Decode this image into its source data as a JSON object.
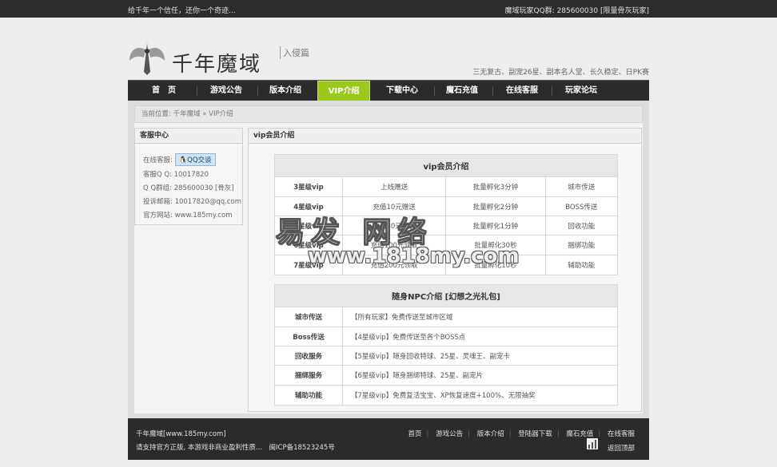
{
  "topbar": {
    "left": "给千年一个信任，还你一个奇迹...",
    "right": "魔域玩家QQ群: 285600030 [限量骨灰玩家]"
  },
  "logo": {
    "name": "千年魔域",
    "sub": "入侵篇"
  },
  "tagline": "三无复古、副宠26星、副本名人堂、长久稳定、日PK赛",
  "nav": [
    "首　页",
    "游戏公告",
    "版本介绍",
    "VIP介绍",
    "下载中心",
    "魔石充值",
    "在线客服",
    "玩家论坛"
  ],
  "nav_active": "VIP介绍",
  "colors": {
    "accent": "#9ac81d",
    "dark": "#2b2b2b"
  },
  "breadcrumb": "当前位置: 千年魔域 » VIP介绍",
  "sidebar": {
    "title": "客服中心",
    "online_label": "在线客服:",
    "qq_button": "QQ交谈",
    "lines": [
      "客服Q Q: 10017820",
      "Q Q群组: 285600030 [骨灰]",
      "投诉邮箱: 10017820@qq.com",
      "官方网站: www.185my.com"
    ]
  },
  "main": {
    "title": "vip会员介绍"
  },
  "vip_table": {
    "title": "vip会员介绍",
    "rows": [
      [
        "3星级vip",
        "上线赠送",
        "批量孵化3分钟",
        "城市传送"
      ],
      [
        "4星级vip",
        "充值10元赠送",
        "批量孵化2分钟",
        "BOSS传送"
      ],
      [
        "5星级vip",
        "充值30元领取",
        "批量孵化1分钟",
        "回收功能"
      ],
      [
        "6星级vip",
        "充值100元领取",
        "批量孵化30秒",
        "捆绑功能"
      ],
      [
        "7星级vip",
        "充值200元领取",
        "批量孵化10秒",
        "辅助功能"
      ]
    ]
  },
  "npc_table": {
    "title": "随身NPC介绍 [幻想之光礼包]",
    "rows": [
      [
        "城市传送",
        "【所有玩家】免费传送至城市区域"
      ],
      [
        "Boss传送",
        "【4星级vip】免费传送至各个BOSS点"
      ],
      [
        "回收服务",
        "【5星级vip】随身回收特球、25星、灵魂王、副宠卡"
      ],
      [
        "捆绑服务",
        "【6星级vip】随身捆绑特球、25星、副宠片"
      ],
      [
        "辅助功能",
        "【7星级vip】免费复活宝宝、XP恢复速度+100%、无限抽奖"
      ]
    ]
  },
  "watermark": {
    "big": "易发 网络",
    "small": "www.1818my.com"
  },
  "footer": {
    "site": "千年魔域[www.185my.com]",
    "notice": "请支持官方正版, 本游戏非商业盈利性质...　闽ICP备18523245号",
    "links": [
      "首页",
      "游戏公告",
      "版本介绍",
      "登陆器下载",
      "魔石充值",
      "在线客服"
    ],
    "back": "返回顶部"
  }
}
